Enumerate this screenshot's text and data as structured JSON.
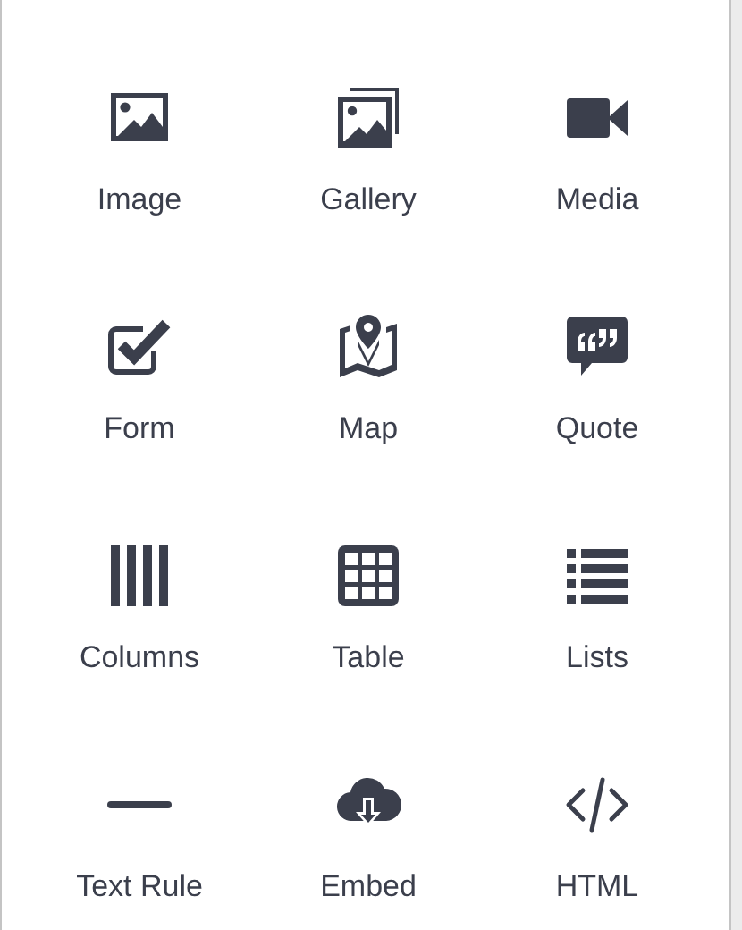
{
  "blocks": [
    {
      "kind": "image",
      "label": "Image"
    },
    {
      "kind": "gallery",
      "label": "Gallery"
    },
    {
      "kind": "media",
      "label": "Media"
    },
    {
      "kind": "form",
      "label": "Form"
    },
    {
      "kind": "map",
      "label": "Map"
    },
    {
      "kind": "quote",
      "label": "Quote"
    },
    {
      "kind": "columns",
      "label": "Columns"
    },
    {
      "kind": "table",
      "label": "Table"
    },
    {
      "kind": "lists",
      "label": "Lists"
    },
    {
      "kind": "rule",
      "label": "Text Rule"
    },
    {
      "kind": "embed",
      "label": "Embed"
    },
    {
      "kind": "html",
      "label": "HTML"
    }
  ]
}
